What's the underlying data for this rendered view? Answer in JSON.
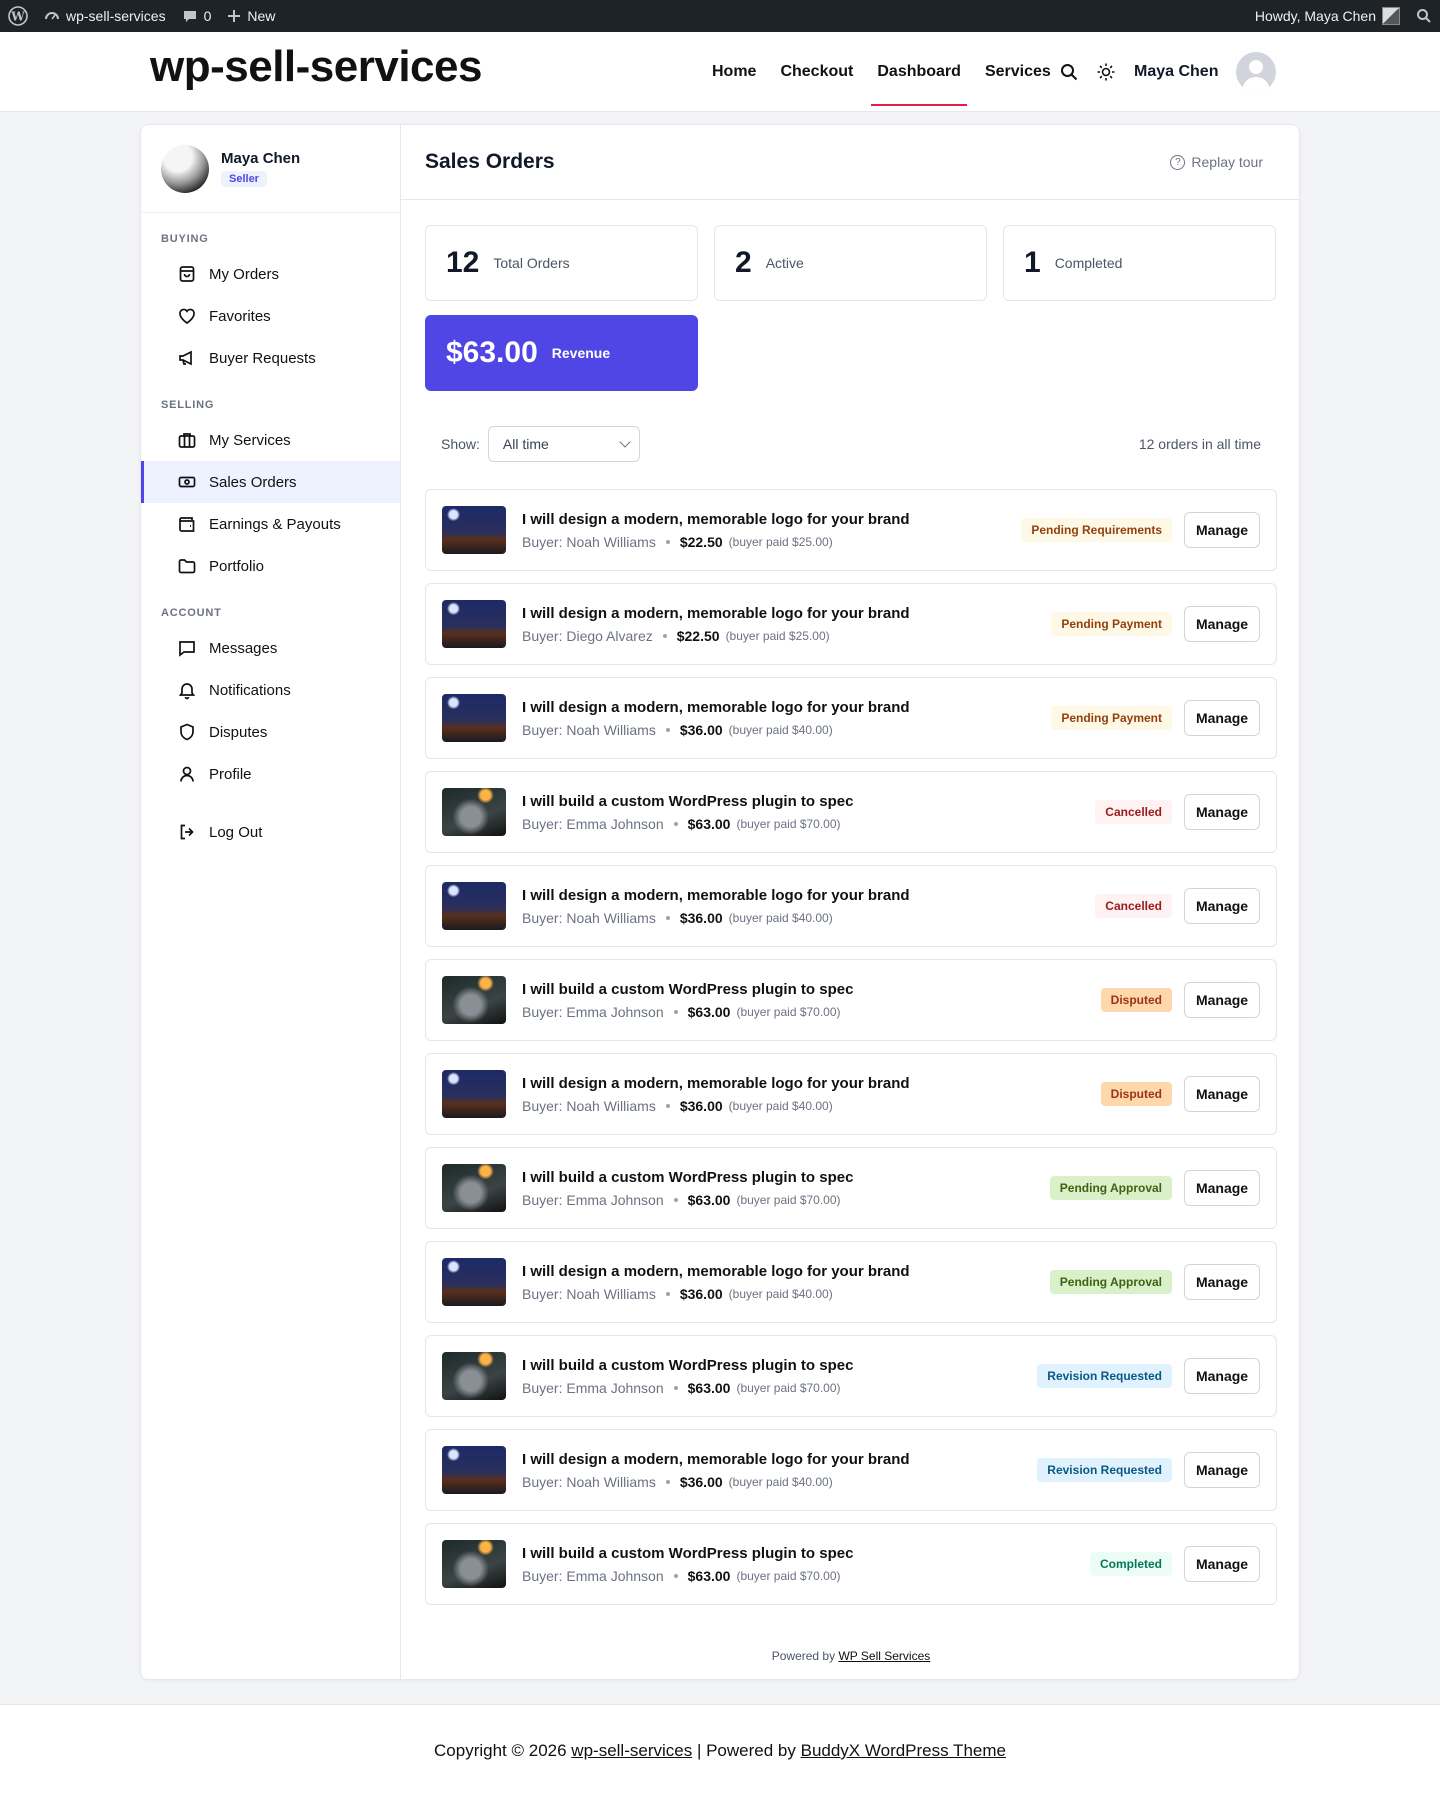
{
  "adminbar": {
    "site": "wp-sell-services",
    "comments": "0",
    "new_label": "New",
    "howdy": "Howdy, Maya Chen"
  },
  "header": {
    "site_title": "wp-sell-services",
    "nav": [
      "Home",
      "Checkout",
      "Dashboard",
      "Services"
    ],
    "active_nav": "Dashboard",
    "user": "Maya Chen"
  },
  "sidebar": {
    "profile": {
      "name": "Maya Chen",
      "role": "Seller"
    },
    "sections": {
      "buying": "BUYING",
      "selling": "SELLING",
      "account": "ACCOUNT"
    },
    "buying_items": [
      "My Orders",
      "Favorites",
      "Buyer Requests"
    ],
    "selling_items": [
      "My Services",
      "Sales Orders",
      "Earnings & Payouts",
      "Portfolio"
    ],
    "account_items": [
      "Messages",
      "Notifications",
      "Disputes",
      "Profile"
    ],
    "logout": "Log Out",
    "active": "Sales Orders"
  },
  "main": {
    "title": "Sales Orders",
    "replay_tour": "Replay tour",
    "stats": {
      "total": {
        "value": "12",
        "label": "Total Orders"
      },
      "active": {
        "value": "2",
        "label": "Active"
      },
      "completed": {
        "value": "1",
        "label": "Completed"
      },
      "revenue": {
        "value": "$63.00",
        "label": "Revenue"
      }
    },
    "filter": {
      "show_label": "Show:",
      "selected": "All time",
      "count_text": "12 orders in all time"
    },
    "manage_label": "Manage",
    "orders": [
      {
        "title": "I will design a modern, memorable logo for your brand",
        "buyer": "Buyer: Noah Williams",
        "amount": "$22.50",
        "paid": "(buyer paid $25.00)",
        "status": "Pending Requirements",
        "thumb": "logo"
      },
      {
        "title": "I will design a modern, memorable logo for your brand",
        "buyer": "Buyer: Diego Alvarez",
        "amount": "$22.50",
        "paid": "(buyer paid $25.00)",
        "status": "Pending Payment",
        "thumb": "logo"
      },
      {
        "title": "I will design a modern, memorable logo for your brand",
        "buyer": "Buyer: Noah Williams",
        "amount": "$36.00",
        "paid": "(buyer paid $40.00)",
        "status": "Pending Payment",
        "thumb": "logo"
      },
      {
        "title": "I will build a custom WordPress plugin to spec",
        "buyer": "Buyer: Emma Johnson",
        "amount": "$63.00",
        "paid": "(buyer paid $70.00)",
        "status": "Cancelled",
        "thumb": "plugin"
      },
      {
        "title": "I will design a modern, memorable logo for your brand",
        "buyer": "Buyer: Noah Williams",
        "amount": "$36.00",
        "paid": "(buyer paid $40.00)",
        "status": "Cancelled",
        "thumb": "logo"
      },
      {
        "title": "I will build a custom WordPress plugin to spec",
        "buyer": "Buyer: Emma Johnson",
        "amount": "$63.00",
        "paid": "(buyer paid $70.00)",
        "status": "Disputed",
        "thumb": "plugin"
      },
      {
        "title": "I will design a modern, memorable logo for your brand",
        "buyer": "Buyer: Noah Williams",
        "amount": "$36.00",
        "paid": "(buyer paid $40.00)",
        "status": "Disputed",
        "thumb": "logo"
      },
      {
        "title": "I will build a custom WordPress plugin to spec",
        "buyer": "Buyer: Emma Johnson",
        "amount": "$63.00",
        "paid": "(buyer paid $70.00)",
        "status": "Pending Approval",
        "thumb": "plugin"
      },
      {
        "title": "I will design a modern, memorable logo for your brand",
        "buyer": "Buyer: Noah Williams",
        "amount": "$36.00",
        "paid": "(buyer paid $40.00)",
        "status": "Pending Approval",
        "thumb": "logo"
      },
      {
        "title": "I will build a custom WordPress plugin to spec",
        "buyer": "Buyer: Emma Johnson",
        "amount": "$63.00",
        "paid": "(buyer paid $70.00)",
        "status": "Revision Requested",
        "thumb": "plugin"
      },
      {
        "title": "I will design a modern, memorable logo for your brand",
        "buyer": "Buyer: Noah Williams",
        "amount": "$36.00",
        "paid": "(buyer paid $40.00)",
        "status": "Revision Requested",
        "thumb": "logo"
      },
      {
        "title": "I will build a custom WordPress plugin to spec",
        "buyer": "Buyer: Emma Johnson",
        "amount": "$63.00",
        "paid": "(buyer paid $70.00)",
        "status": "Completed",
        "thumb": "plugin"
      }
    ],
    "powered_prefix": "Powered by",
    "powered_link": "WP Sell Services"
  },
  "footer": {
    "copyright": "Copyright © 2026",
    "site_link": "wp-sell-services",
    "separator": "| Powered by",
    "theme_link": "BuddyX WordPress Theme"
  },
  "colors": {
    "accent": "#4f46e5",
    "nav_active_underline": "#e11d48",
    "adminbar": "#1d2327"
  }
}
